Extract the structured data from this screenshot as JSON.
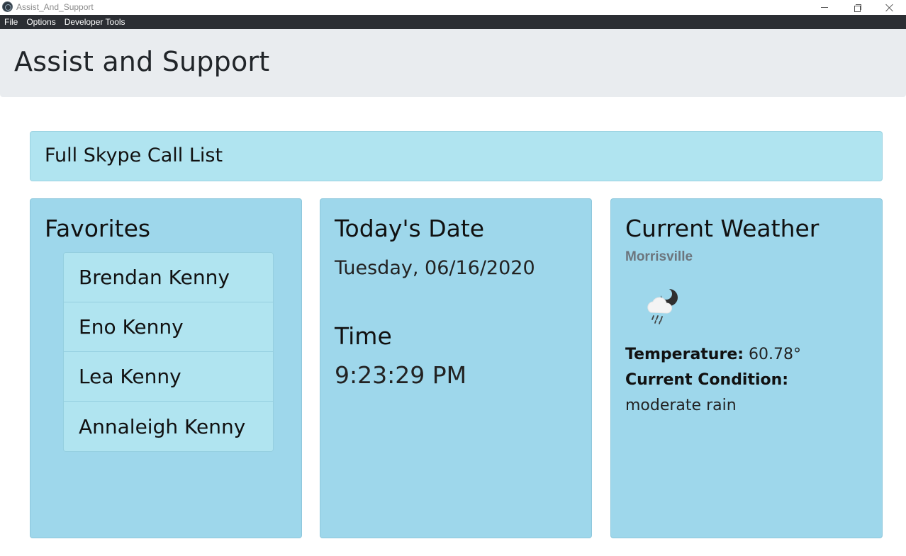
{
  "window": {
    "title": "Assist_And_Support",
    "controls": [
      "minimize-icon",
      "restore-icon",
      "close-icon"
    ]
  },
  "menu": {
    "items": [
      "File",
      "Options",
      "Developer Tools"
    ]
  },
  "header": {
    "title": "Assist and Support"
  },
  "call_list": {
    "label": "Full Skype Call List"
  },
  "favorites": {
    "title": "Favorites",
    "contacts": [
      "Brendan Kenny",
      "Eno Kenny",
      "Lea Kenny",
      "Annaleigh Kenny"
    ]
  },
  "date_card": {
    "title": "Today's Date",
    "date": "Tuesday, 06/16/2020",
    "time_title": "Time",
    "time": "9:23:29 PM"
  },
  "weather": {
    "title": "Current Weather",
    "city": "Morrisville",
    "icon": "night-rain-icon",
    "temperature_label": "Temperature:",
    "temperature_value": "60.78°",
    "condition_label": "Current Condition:",
    "condition_value": "moderate rain"
  },
  "colors": {
    "menubar": "#2b2e33",
    "jumbotron": "#e9ecef",
    "call_list_bg": "#b0e4f0",
    "card_bg": "#9ed7eb",
    "list_item_bg": "#b0e4f0",
    "muted_text": "#6c757d"
  }
}
